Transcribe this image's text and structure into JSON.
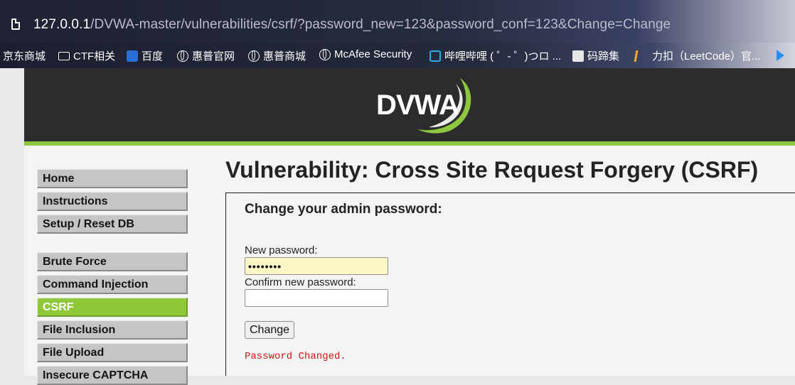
{
  "browser": {
    "url_host": "127.0.0.1",
    "url_path": "/DVWA-master/vulnerabilities/csrf/?password_new=123&password_conf=123&Change=Change",
    "bookmarks": [
      {
        "label": "京东商城",
        "icon": "none"
      },
      {
        "label": "CTF相关",
        "icon": "folder-icon"
      },
      {
        "label": "百度",
        "icon": "baidu-paw-icon"
      },
      {
        "label": "惠普官网",
        "icon": "globe-icon"
      },
      {
        "label": "惠普商城",
        "icon": "globe-icon"
      },
      {
        "label": "McAfee Security",
        "icon": "globe-icon"
      },
      {
        "label": "哔哩哔哩 ( ゜- ゜)つロ ...",
        "icon": "bilibili-tv-icon"
      },
      {
        "label": "码蹄集",
        "icon": "code-icon"
      },
      {
        "label": "力扣（LeetCode）官...",
        "icon": "leetcode-icon"
      },
      {
        "label": "",
        "icon": "play-icon"
      }
    ]
  },
  "logo": {
    "text": "DVWA"
  },
  "colors": {
    "accent": "#8dc63f",
    "header_bg": "#2c2c2c",
    "error_text": "#d21414"
  },
  "menu": {
    "items": [
      {
        "label": "Home",
        "selected": false
      },
      {
        "label": "Instructions",
        "selected": false
      },
      {
        "label": "Setup / Reset DB",
        "selected": false
      },
      {
        "label": "Brute Force",
        "selected": false
      },
      {
        "label": "Command Injection",
        "selected": false
      },
      {
        "label": "CSRF",
        "selected": true
      },
      {
        "label": "File Inclusion",
        "selected": false
      },
      {
        "label": "File Upload",
        "selected": false
      },
      {
        "label": "Insecure CAPTCHA",
        "selected": false
      }
    ]
  },
  "main": {
    "title": "Vulnerability: Cross Site Request Forgery (CSRF)",
    "form": {
      "heading": "Change your admin password:",
      "new_password_label": "New password:",
      "new_password_value": "••••••••",
      "confirm_password_label": "Confirm new password:",
      "confirm_password_value": "",
      "submit_label": "Change",
      "status": "Password Changed."
    }
  }
}
